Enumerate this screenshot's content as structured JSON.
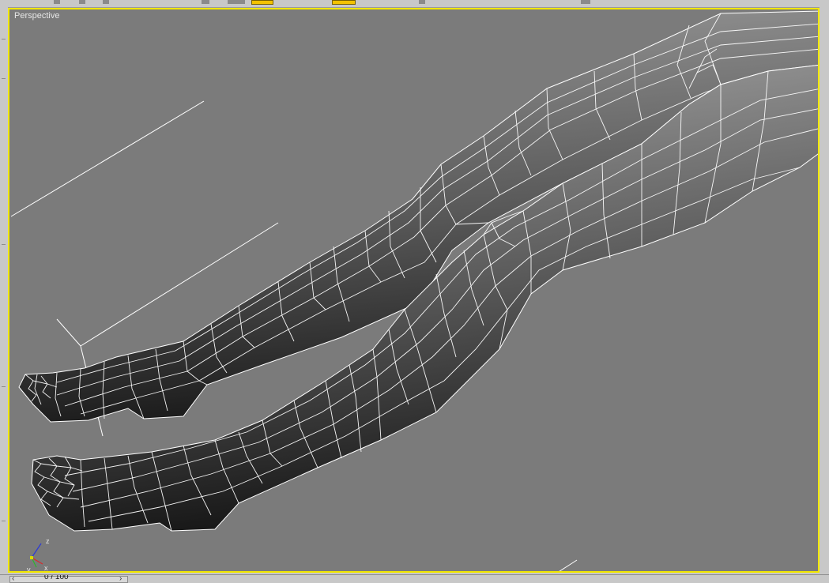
{
  "viewport": {
    "label": "Perspective",
    "border_color": "#f2e800",
    "background_color": "#7b7b7b",
    "wire_color": "#ffffff"
  },
  "axis_gizmo": {
    "z_label": "z",
    "x_label": "x",
    "y_label": "y"
  },
  "timeline": {
    "frame_readout": "0 / 100",
    "prev_icon": "chevron-left-icon",
    "next_icon": "chevron-right-icon"
  }
}
